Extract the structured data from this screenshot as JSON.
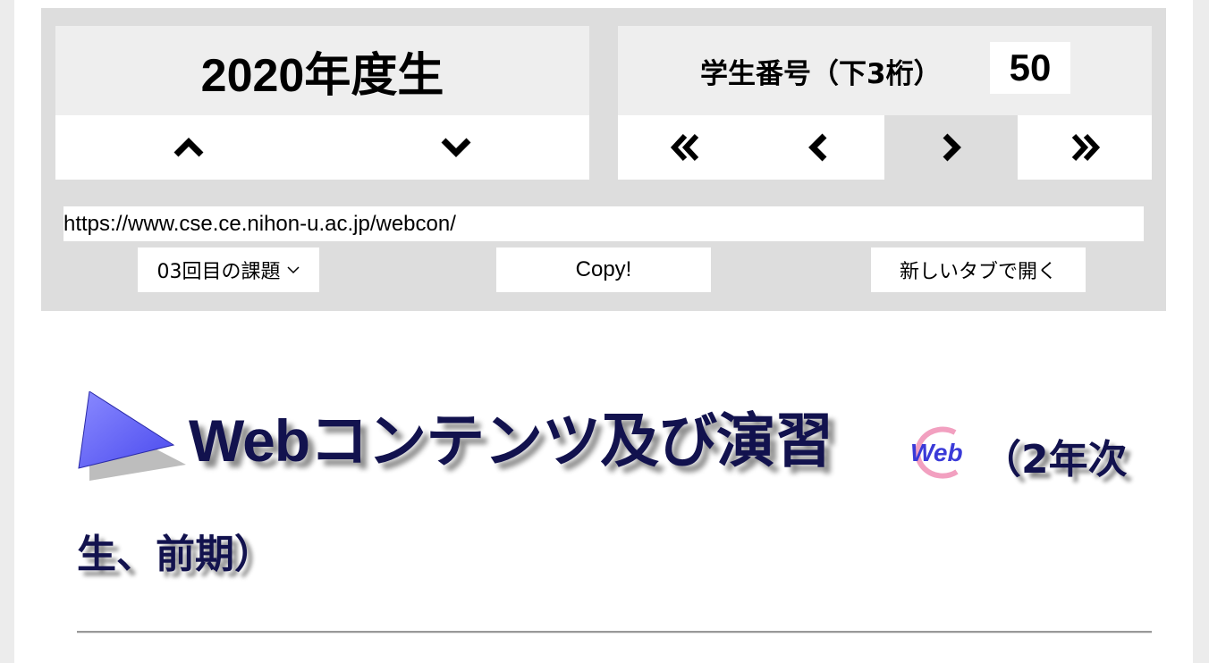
{
  "year_selector": {
    "title": "2020年度生",
    "up_icon": "chevron-up-icon",
    "down_icon": "chevron-down-icon"
  },
  "student_selector": {
    "label": "学生番号（下3桁）",
    "number": "50",
    "icons": [
      "double-chevron-left-icon",
      "chevron-left-icon",
      "chevron-right-icon",
      "double-chevron-right-icon"
    ],
    "active_color": "#dddddd"
  },
  "url_bar": {
    "value": "https://www.cse.ce.nihon-u.ac.jp/webcon/"
  },
  "actions": {
    "assignment_select": "03回目の課題",
    "copy_label": "Copy!",
    "new_tab_label": "新しいタブで開く"
  },
  "heading": {
    "main": "Webコンテンツ及び演習",
    "badge_text": "Web",
    "suffix": "（2年次",
    "line2": "生、前期）",
    "color": "#12124e"
  }
}
